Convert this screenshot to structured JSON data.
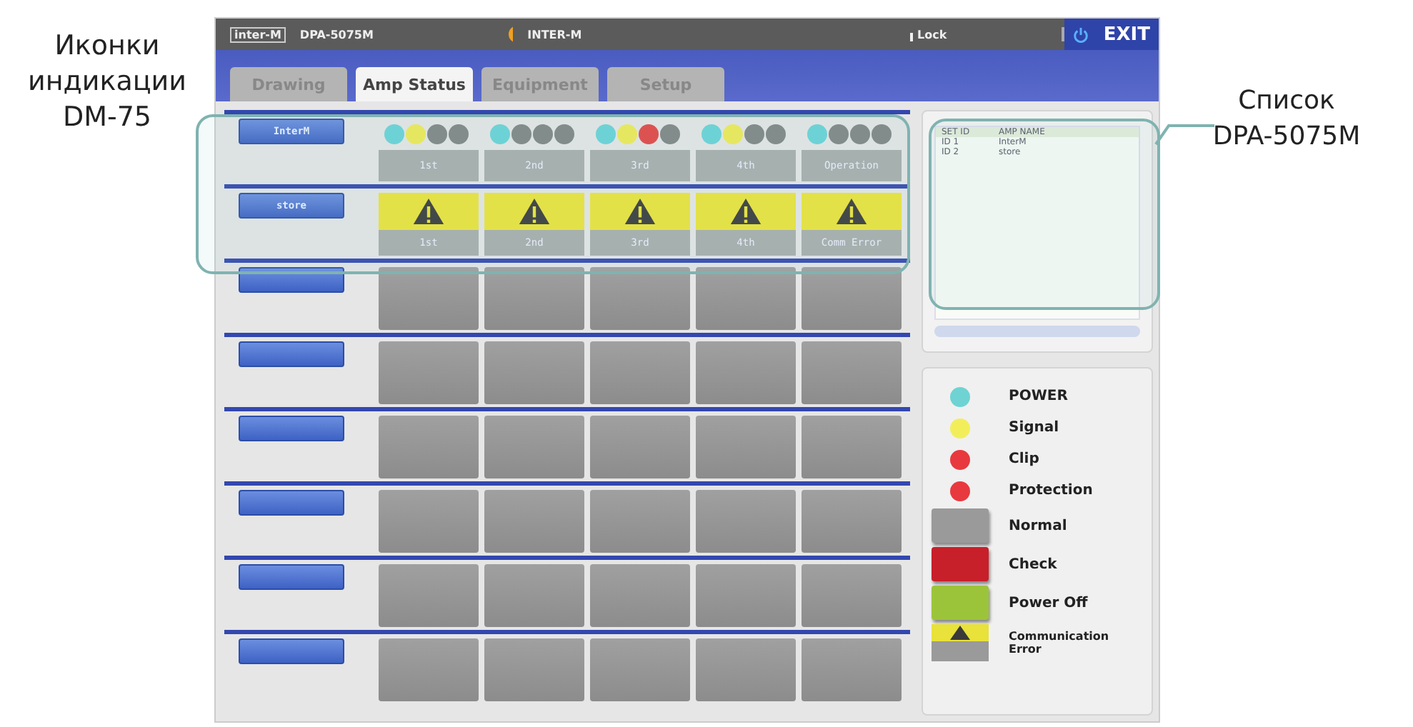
{
  "callouts": [
    {
      "text": "Иконки индикации DM-75"
    },
    {
      "text": "Список DPA-5075M"
    }
  ],
  "topbar": {
    "logo": "inter-M",
    "model": "DPA-5075M",
    "site": "INTER-M",
    "lock": "Lock",
    "exit": "EXIT"
  },
  "tabs": [
    {
      "label": "Drawing",
      "selected": false
    },
    {
      "label": "Amp Status",
      "selected": true
    },
    {
      "label": "Equipment",
      "selected": false
    },
    {
      "label": "Setup",
      "selected": false
    }
  ],
  "amps": [
    {
      "name": "InterM",
      "cells": [
        {
          "kind": "leds",
          "leds": [
            {
              "color": "#69d3d8"
            },
            {
              "color": "#f0ea55"
            },
            {
              "color": "#7f8585"
            },
            {
              "color": "#7f8585"
            }
          ],
          "label": "1st"
        },
        {
          "kind": "leds",
          "leds": [
            {
              "color": "#69d3d8"
            },
            {
              "color": "#7f8585"
            },
            {
              "color": "#7f8585"
            },
            {
              "color": "#7f8585"
            }
          ],
          "label": "2nd"
        },
        {
          "kind": "leds",
          "leds": [
            {
              "color": "#69d3d8"
            },
            {
              "color": "#f0ea55"
            },
            {
              "color": "#e54444"
            },
            {
              "color": "#7f8585"
            }
          ],
          "label": "3rd"
        },
        {
          "kind": "leds",
          "leds": [
            {
              "color": "#69d3d8"
            },
            {
              "color": "#f0ea55"
            },
            {
              "color": "#7f8585"
            },
            {
              "color": "#7f8585"
            }
          ],
          "label": "4th"
        },
        {
          "kind": "leds",
          "leds": [
            {
              "color": "#69d3d8"
            },
            {
              "color": "#7f8585"
            },
            {
              "color": "#7f8585"
            },
            {
              "color": "#7f8585"
            }
          ],
          "label": "Operation"
        }
      ]
    },
    {
      "name": "store",
      "cells": [
        {
          "kind": "warning",
          "label": "1st"
        },
        {
          "kind": "warning",
          "label": "2nd"
        },
        {
          "kind": "warning",
          "label": "3rd"
        },
        {
          "kind": "warning",
          "label": "4th"
        },
        {
          "kind": "warning",
          "label": "Comm Error"
        }
      ]
    },
    {
      "cells": [
        {
          "kind": "empty"
        },
        {
          "kind": "empty"
        },
        {
          "kind": "empty"
        },
        {
          "kind": "empty"
        },
        {
          "kind": "empty"
        }
      ]
    },
    {
      "cells": [
        {
          "kind": "empty"
        },
        {
          "kind": "empty"
        },
        {
          "kind": "empty"
        },
        {
          "kind": "empty"
        },
        {
          "kind": "empty"
        }
      ]
    },
    {
      "cells": [
        {
          "kind": "empty"
        },
        {
          "kind": "empty"
        },
        {
          "kind": "empty"
        },
        {
          "kind": "empty"
        },
        {
          "kind": "empty"
        }
      ]
    },
    {
      "cells": [
        {
          "kind": "empty"
        },
        {
          "kind": "empty"
        },
        {
          "kind": "empty"
        },
        {
          "kind": "empty"
        },
        {
          "kind": "empty"
        }
      ]
    },
    {
      "cells": [
        {
          "kind": "empty"
        },
        {
          "kind": "empty"
        },
        {
          "kind": "empty"
        },
        {
          "kind": "empty"
        },
        {
          "kind": "empty"
        }
      ]
    },
    {
      "cells": [
        {
          "kind": "empty"
        },
        {
          "kind": "empty"
        },
        {
          "kind": "empty"
        },
        {
          "kind": "empty"
        },
        {
          "kind": "empty"
        }
      ]
    }
  ],
  "amp_list": {
    "columns": [
      "SET ID",
      "AMP NAME"
    ],
    "rows": [
      [
        "ID 1",
        "InterM"
      ],
      [
        "ID 2",
        "store"
      ]
    ]
  },
  "legend": [
    {
      "kind": "led",
      "color": "#6fd3d3",
      "label": "POWER"
    },
    {
      "kind": "led",
      "color": "#f2ee5a",
      "label": "Signal"
    },
    {
      "kind": "led",
      "color": "#e8393f",
      "label": "Clip"
    },
    {
      "kind": "led",
      "color": "#e8393f",
      "label": "Protection"
    },
    {
      "kind": "block",
      "color": "#9a9a9a",
      "label": "Normal"
    },
    {
      "kind": "block",
      "color": "#c8202a",
      "label": "Check"
    },
    {
      "kind": "block",
      "color": "#9cc43a",
      "label": "Power Off"
    },
    {
      "kind": "warning",
      "color": "#e8e23a",
      "label": "Communication Error"
    }
  ]
}
